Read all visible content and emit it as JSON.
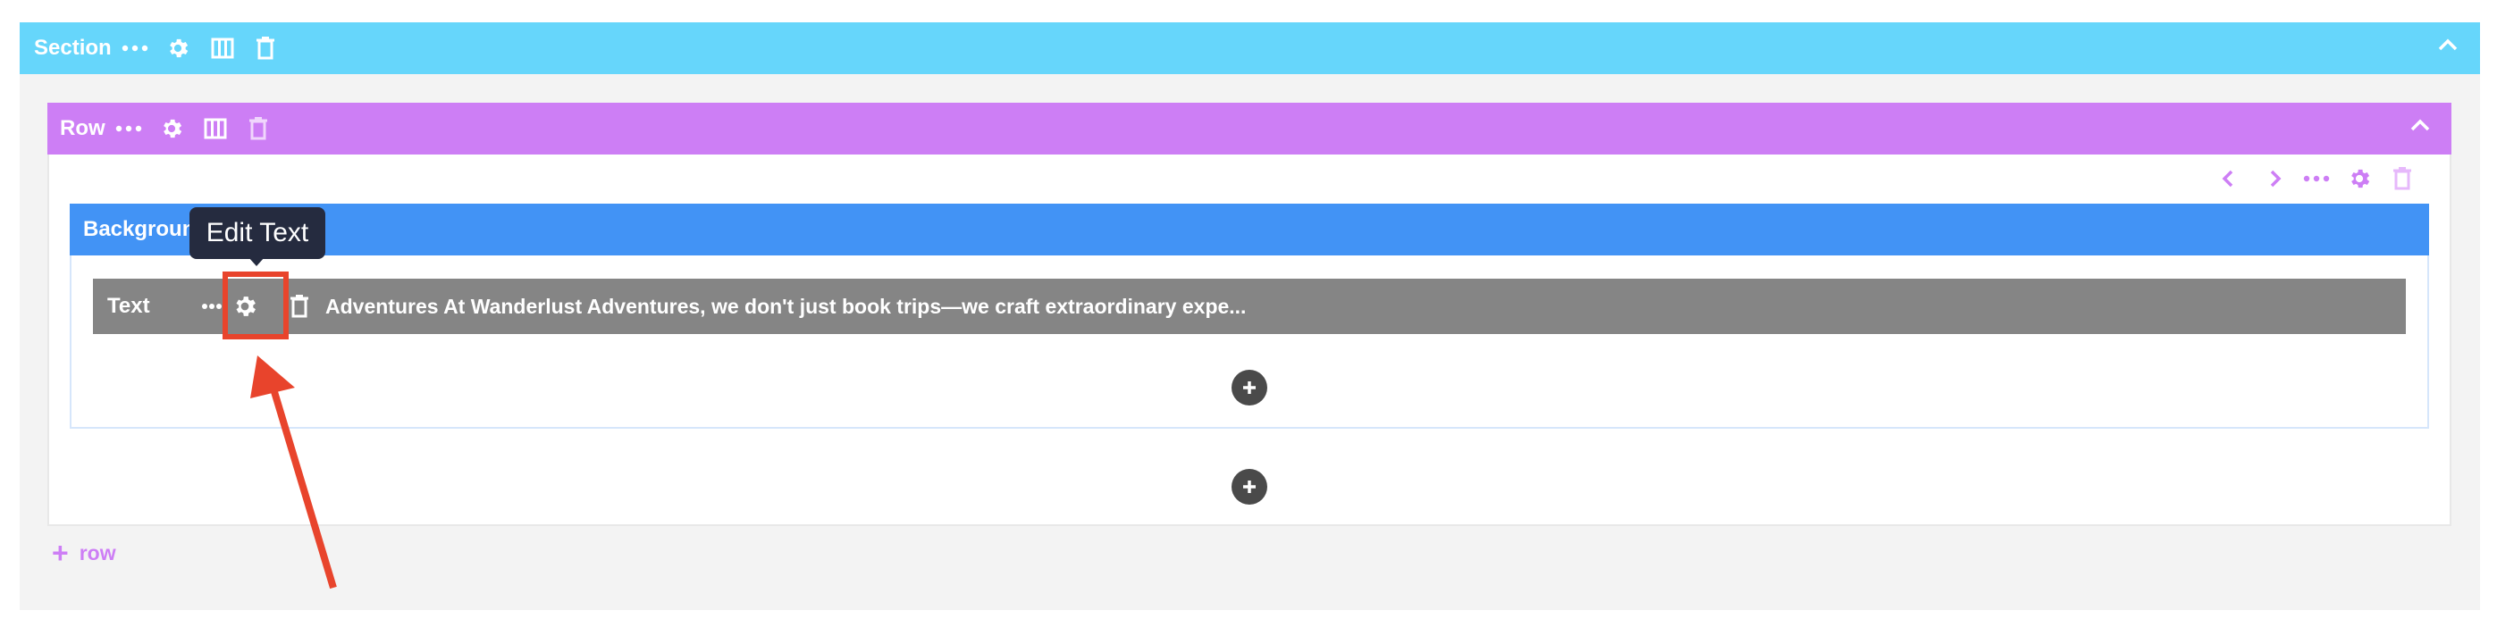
{
  "section": {
    "label": "Section"
  },
  "row": {
    "label": "Row"
  },
  "column": {
    "label": "Background"
  },
  "text_module": {
    "label": "Text",
    "preview": "Adventures At Wanderlust Adventures, we don't just book trips—we craft extraordinary expe..."
  },
  "tooltip": {
    "text": "Edit Text"
  },
  "add_row": {
    "plus": "+",
    "label": "row"
  },
  "colors": {
    "section": "#66d6fb",
    "row": "#cd7ef5",
    "column": "#4293f5",
    "module": "#858585",
    "highlight": "#e8442c",
    "tooltip": "#252b3f"
  },
  "icons": [
    "more-icon",
    "gear-icon",
    "columns-icon",
    "trash-icon",
    "chevron-up-icon",
    "chevron-left-icon",
    "chevron-right-icon",
    "plus-circle-icon",
    "arrow-icon"
  ]
}
